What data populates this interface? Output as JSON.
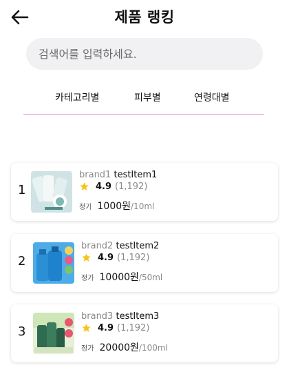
{
  "header": {
    "title": "제품 랭킹",
    "back_icon": "arrow-left-icon"
  },
  "search": {
    "placeholder": "검색어를 입력하세요."
  },
  "tabs": [
    {
      "label": "카테고리별"
    },
    {
      "label": "피부별"
    },
    {
      "label": "연령대별"
    }
  ],
  "colors": {
    "tab_underline": "#e79ad9",
    "star": "#f5c518",
    "search_bg": "#f1f1f3"
  },
  "products": [
    {
      "rank": "1",
      "brand": "brand1",
      "item": "testItem1",
      "score": "4.9",
      "count": "(1,192)",
      "price_label": "정가",
      "price": "1000원",
      "volume": "/10ml",
      "icon": "product-tube-image"
    },
    {
      "rank": "2",
      "brand": "brand2",
      "item": "testItem2",
      "score": "4.9",
      "count": "(1,192)",
      "price_label": "정가",
      "price": "10000원",
      "volume": "/50ml",
      "icon": "product-bottle-image"
    },
    {
      "rank": "3",
      "brand": "brand3",
      "item": "testItem3",
      "score": "4.9",
      "count": "(1,192)",
      "price_label": "정가",
      "price": "20000원",
      "volume": "/100ml",
      "icon": "product-set-image"
    }
  ]
}
